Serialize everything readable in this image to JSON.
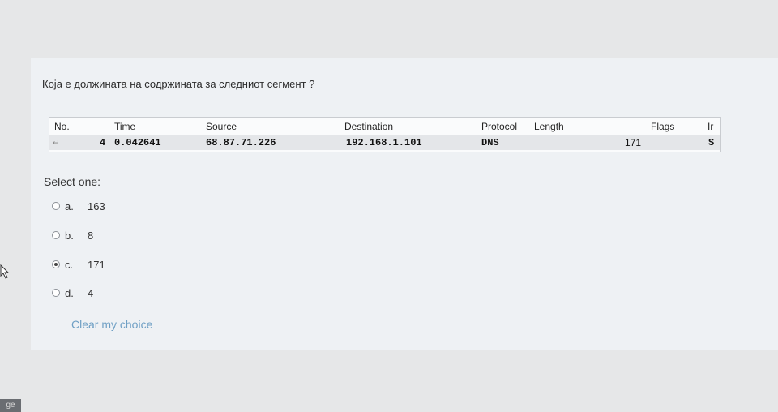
{
  "question": {
    "text": "Која е должината на содржината за следниот сегмент ?"
  },
  "packet_table": {
    "headers": [
      "No.",
      "Time",
      "Source",
      "Destination",
      "Protocol",
      "Length",
      "Flags",
      "Ir"
    ],
    "row": {
      "no": "4",
      "time": "0.042641",
      "source": "68.87.71.226",
      "destination": "192.168.1.101",
      "protocol": "DNS",
      "length": "171",
      "info": "S"
    }
  },
  "answer": {
    "prompt": "Select one:",
    "options": [
      {
        "letter": "a.",
        "value": "163",
        "selected": false
      },
      {
        "letter": "b.",
        "value": "8",
        "selected": false
      },
      {
        "letter": "c.",
        "value": "171",
        "selected": true
      },
      {
        "letter": "d.",
        "value": "4",
        "selected": false
      }
    ],
    "clear_label": "Clear my choice"
  },
  "corner_tab": {
    "label": "ge"
  }
}
